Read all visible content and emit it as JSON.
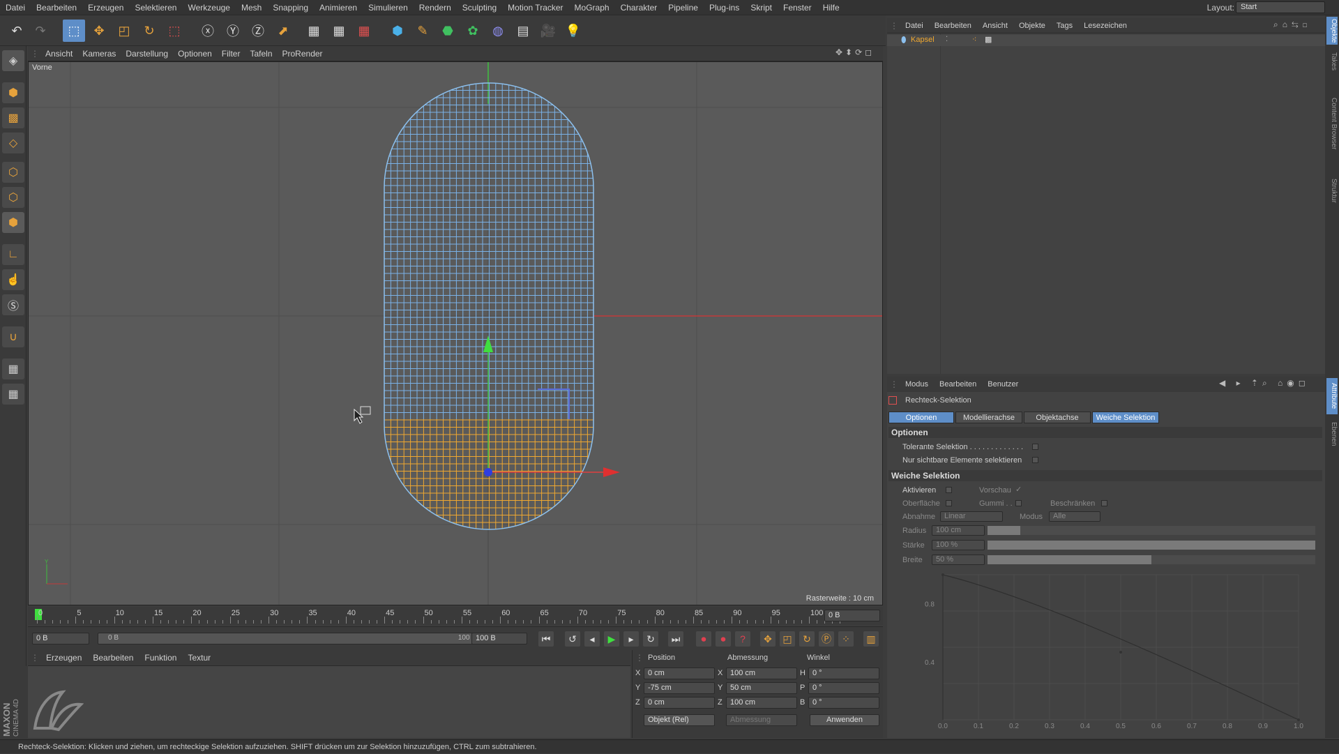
{
  "menubar": {
    "items": [
      "Datei",
      "Bearbeiten",
      "Erzeugen",
      "Selektieren",
      "Werkzeuge",
      "Mesh",
      "Snapping",
      "Animieren",
      "Simulieren",
      "Rendern",
      "Sculpting",
      "Motion Tracker",
      "MoGraph",
      "Charakter",
      "Pipeline",
      "Plug-ins",
      "Skript",
      "Fenster",
      "Hilfe"
    ],
    "layout_label": "Layout:",
    "layout_value": "Start"
  },
  "viewport": {
    "menu": [
      "Ansicht",
      "Kameras",
      "Darstellung",
      "Optionen",
      "Filter",
      "Tafeln",
      "ProRender"
    ],
    "view_name": "Vorne",
    "grid_info": "Rasterweite : 10 cm",
    "axis_y": "Y"
  },
  "timeline": {
    "ticks": [
      "0",
      "5",
      "10",
      "15",
      "20",
      "25",
      "30",
      "35",
      "40",
      "45",
      "50",
      "55",
      "60",
      "65",
      "70",
      "75",
      "80",
      "85",
      "90",
      "95",
      "100"
    ],
    "current_frame": "0 B"
  },
  "transport": {
    "start_field": "0 B",
    "range_start": "0 B",
    "range_end": "100 B",
    "end_field": "100 B"
  },
  "material_menu": [
    "Erzeugen",
    "Bearbeiten",
    "Funktion",
    "Textur"
  ],
  "branding": {
    "maxon": "MAXON",
    "cinema": "CINEMA 4D"
  },
  "coords": {
    "headers": [
      "Position",
      "Abmessung",
      "Winkel"
    ],
    "rows": [
      {
        "axis": "X",
        "pos": "0 cm",
        "dim_axis": "X",
        "dim": "100 cm",
        "ang_axis": "H",
        "ang": "0 °"
      },
      {
        "axis": "Y",
        "pos": "-75 cm",
        "dim_axis": "Y",
        "dim": "50 cm",
        "ang_axis": "P",
        "ang": "0 °"
      },
      {
        "axis": "Z",
        "pos": "0 cm",
        "dim_axis": "Z",
        "dim": "100 cm",
        "ang_axis": "B",
        "ang": "0 °"
      }
    ],
    "mode_select": "Objekt (Rel)",
    "size_select": "Abmessung",
    "apply_label": "Anwenden"
  },
  "object_manager": {
    "menu": [
      "Datei",
      "Bearbeiten",
      "Ansicht",
      "Objekte",
      "Tags",
      "Lesezeichen"
    ],
    "object_name": "Kapsel"
  },
  "attribute_manager": {
    "menu": [
      "Modus",
      "Bearbeiten",
      "Benutzer"
    ],
    "tool_name": "Rechteck-Selektion",
    "tabs": [
      "Optionen",
      "Modellierachse",
      "Objektachse",
      "Weiche Selektion"
    ],
    "section_options": "Optionen",
    "tolerant": "Tolerante Selektion . . . . . . . . . . . . .",
    "only_visible": "Nur sichtbare Elemente selektieren",
    "section_soft": "Weiche Selektion",
    "activate": "Aktivieren",
    "preview": "Vorschau",
    "surface": "Oberfläche",
    "rubber": "Gummi . .",
    "restrict": "Beschränken",
    "falloff_label": "Abnahme",
    "falloff_value": "Linear",
    "mode_label": "Modus",
    "mode_value": "Alle",
    "radius_label": "Radius",
    "radius_value": "100 cm",
    "strength_label": "Stärke",
    "strength_value": "100 %",
    "width_label": "Breite",
    "width_value": "50 %",
    "graph_y": [
      "0.8",
      "0.4"
    ],
    "graph_x": [
      "0.0",
      "0.1",
      "0.2",
      "0.3",
      "0.4",
      "0.5",
      "0.6",
      "0.7",
      "0.8",
      "0.9",
      "1.0"
    ]
  },
  "right_tabs": [
    "Objekte",
    "Takes",
    "Content Browser",
    "Struktur",
    "Attribute",
    "Ebenen"
  ],
  "statusbar": "Rechteck-Selektion: Klicken und ziehen, um rechteckige Selektion aufzuziehen. SHIFT drücken um zur Selektion hinzuzufügen, CTRL zum subtrahieren.",
  "colors": {
    "accent": "#5e8ec8",
    "selection": "#f0a830",
    "wire": "#7ab2e8"
  }
}
